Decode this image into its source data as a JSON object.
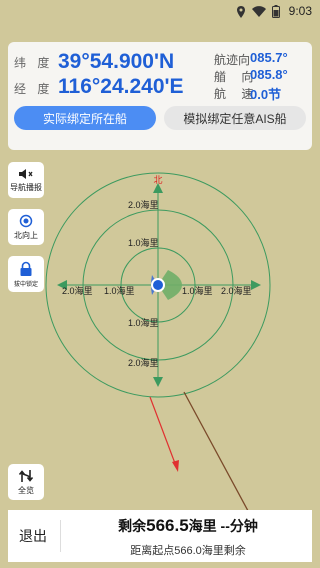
{
  "status": {
    "time": "9:03"
  },
  "position": {
    "lat_label": "纬  度",
    "lat_value": "39°54.900'N",
    "lon_label": "经  度",
    "lon_value": "116°24.240'E"
  },
  "nav": {
    "track_label": "航迹向",
    "track_value": "085.7°",
    "heading_label": "艏  向",
    "heading_value": "085.8°",
    "speed_label": "航  速",
    "speed_value": "0.0节"
  },
  "buttons": {
    "bind_actual": "实际绑定所在船",
    "bind_sim": "模拟绑定任意AIS船"
  },
  "side": {
    "voice": "导航播报",
    "north_up": "北向上",
    "lock": "拔中锁定",
    "overview": "全览"
  },
  "radar": {
    "north": "北",
    "ring_labels": [
      "2.0海里",
      "1.0海里",
      "1.0海里",
      "2.0海里",
      "1.0海里",
      "2.0海里",
      "1.0海里",
      "2.0海里"
    ]
  },
  "bottom": {
    "exit": "退出",
    "remain_prefix": "剩余",
    "remain_value": "566.5",
    "remain_unit": "海里",
    "remain_time": "--分钟",
    "distance": "距离起点566.0海里剩余"
  }
}
